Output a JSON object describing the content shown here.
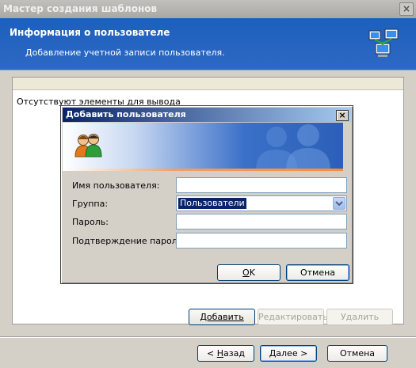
{
  "window": {
    "title": "Мастер создания шаблонов",
    "close_label": "×"
  },
  "header": {
    "title": "Информация о пользователе",
    "subtitle": "Добавление учетной записи пользователя.",
    "icon": "network-computers-icon"
  },
  "list": {
    "empty_text": "Отсутствуют элементы для вывода"
  },
  "list_buttons": {
    "add": "Добавить",
    "edit": "Редактировать",
    "delete": "Удалить"
  },
  "nav_buttons": {
    "back_prefix": "< ",
    "back_mnemonic": "Н",
    "back_rest": "азад",
    "next_mnemonic": "Д",
    "next_rest": "алее >",
    "cancel": "Отмена"
  },
  "dialog": {
    "title": "Добавить пользователя",
    "close_label": "×",
    "banner_icon": "users-icon",
    "fields": {
      "username_label": "Имя пользователя:",
      "username_value": "",
      "group_label": "Группа:",
      "group_value": "Пользователи",
      "password_label": "Пароль:",
      "password_value": "",
      "confirm_label": "Подтверждение пароля:",
      "confirm_value": ""
    },
    "ok_mnemonic": "O",
    "ok_rest": "K",
    "cancel": "Отмена"
  },
  "colors": {
    "header_blue": "#1d5fbd",
    "dialog_title_blue": "#0a246a",
    "selection": "#0a246a"
  }
}
